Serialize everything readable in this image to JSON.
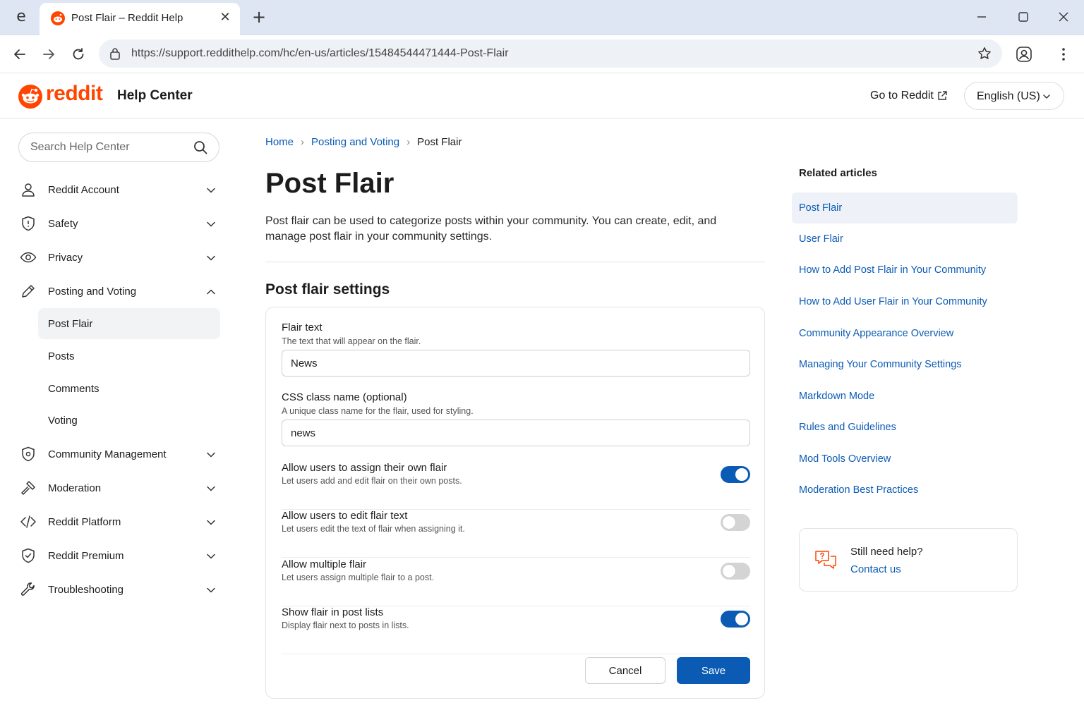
{
  "browser": {
    "tab_title": "Post Flair – Reddit Help",
    "url": "https://support.reddithelp.com/hc/en-us/articles/15484544471444-Post-Flair"
  },
  "header": {
    "wordmark": "reddit",
    "help_center": "Help Center",
    "go_to_reddit": "Go to Reddit",
    "language": "English (US)"
  },
  "sidebar": {
    "search_placeholder": "Search Help Center",
    "items": [
      {
        "label": "Reddit Account",
        "icon": "user-icon"
      },
      {
        "label": "Safety",
        "icon": "shield-icon"
      },
      {
        "label": "Privacy",
        "icon": "eye-icon"
      },
      {
        "label": "Posting and Voting",
        "icon": "pencil-icon",
        "expanded": true
      },
      {
        "label": "Community Management",
        "icon": "shield-gear-icon"
      },
      {
        "label": "Moderation",
        "icon": "gavel-icon"
      },
      {
        "label": "Reddit Platform",
        "icon": "code-icon"
      },
      {
        "label": "Reddit Premium",
        "icon": "shield-check-icon"
      },
      {
        "label": "Troubleshooting",
        "icon": "wrench-icon"
      }
    ],
    "sub_items": [
      {
        "label": "Post Flair",
        "active": true
      },
      {
        "label": "Posts"
      },
      {
        "label": "Comments"
      },
      {
        "label": "Voting"
      }
    ]
  },
  "breadcrumb": {
    "home": "Home",
    "section": "Posting and Voting",
    "current": "Post Flair"
  },
  "article": {
    "title": "Post Flair",
    "intro": "Post flair can be used to categorize posts within your community. You can create, edit, and manage post flair in your community settings.",
    "section_title": "Post flair settings"
  },
  "form": {
    "flair_text": {
      "label": "Flair text",
      "help": "The text that will appear on the flair.",
      "value": "News"
    },
    "css_class": {
      "label": "CSS class name (optional)",
      "help": "A unique class name for the flair, used for styling.",
      "value": "news"
    },
    "toggles": [
      {
        "label": "Allow users to assign their own flair",
        "help": "Let users add and edit flair on their own posts.",
        "on": true
      },
      {
        "label": "Allow users to edit flair text",
        "help": "Let users edit the text of flair when assigning it.",
        "on": false
      },
      {
        "label": "Allow multiple flair",
        "help": "Let users assign multiple flair to a post.",
        "on": false
      },
      {
        "label": "Show flair in post lists",
        "help": "Display flair next to posts in lists.",
        "on": true
      }
    ],
    "cancel_label": "Cancel",
    "save_label": "Save"
  },
  "related": {
    "title": "Related articles",
    "items": [
      "Post Flair",
      "User Flair",
      "How to Add Post Flair in Your Community",
      "How to Add User Flair in Your Community",
      "Community Appearance Overview",
      "Managing Your Community Settings",
      "Markdown Mode",
      "Rules and Guidelines",
      "Mod Tools Overview",
      "Moderation Best Practices"
    ]
  },
  "help_card": {
    "title": "Still need help?",
    "link": "Contact us"
  },
  "colors": {
    "brand": "#ff4500",
    "link": "#0b5bb5",
    "toggle_on": "#0b5bb5",
    "toggle_off": "#d4d4d4"
  }
}
